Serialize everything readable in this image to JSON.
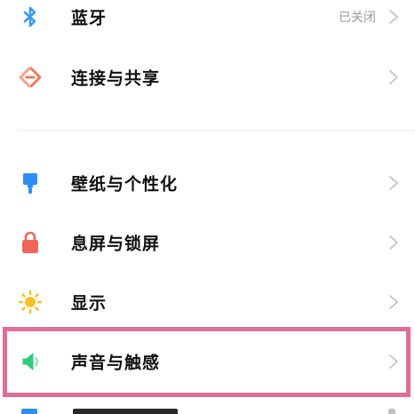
{
  "settings": {
    "items": [
      {
        "label": "蓝牙",
        "status": "已关闭",
        "icon": "bluetooth-icon",
        "icon_color": "#3b9cf0"
      },
      {
        "label": "连接与共享",
        "status": "",
        "icon": "connection-sharing-icon",
        "icon_color": "#ec7a5c"
      },
      {
        "label": "壁纸与个性化",
        "status": "",
        "icon": "wallpaper-brush-icon",
        "icon_color": "#2f8ef5"
      },
      {
        "label": "息屏与锁屏",
        "status": "",
        "icon": "lock-icon",
        "icon_color": "#f0665a"
      },
      {
        "label": "显示",
        "status": "",
        "icon": "sun-icon",
        "icon_color": "#f5c127"
      },
      {
        "label": "声音与触感",
        "status": "",
        "icon": "speaker-icon",
        "icon_color": "#2fcb7e"
      }
    ]
  },
  "colors": {
    "highlight_border": "#e06f97",
    "chevron": "#c2c2c2",
    "status_text": "#9a9a9a"
  }
}
